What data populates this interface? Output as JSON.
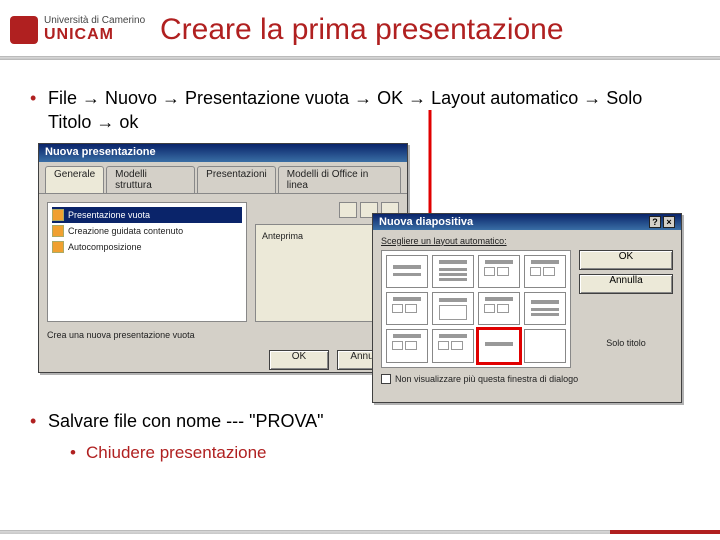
{
  "logo": {
    "uni_line1": "Università di Camerino",
    "brand": "UNICAM"
  },
  "title": "Creare la prima presentazione",
  "bullets": {
    "steps": "File → Nuovo → Presentazione vuota → OK → Layout automatico → Solo Titolo → ok",
    "save": "Salvare file con nome --- \"PROVA\"",
    "close": "Chiudere presentazione"
  },
  "dialog1": {
    "title": "Nuova presentazione",
    "tabs": [
      "Generale",
      "Modelli struttura",
      "Presentazioni",
      "Modelli di Office in linea"
    ],
    "items": [
      "Presentazione vuota",
      "Creazione guidata contenuto",
      "Autocomposizione"
    ],
    "preview_label": "Anteprima",
    "hint": "Crea una nuova presentazione vuota",
    "ok": "OK",
    "cancel": "Annulla"
  },
  "dialog2": {
    "title": "Nuova diapositiva",
    "prompt": "Scegliere un layout automatico:",
    "ok": "OK",
    "cancel": "Annulla",
    "selected_caption": "Solo titolo",
    "checkbox": "Non visualizzare più questa finestra di dialogo",
    "close_glyph": "×",
    "help_glyph": "?"
  }
}
